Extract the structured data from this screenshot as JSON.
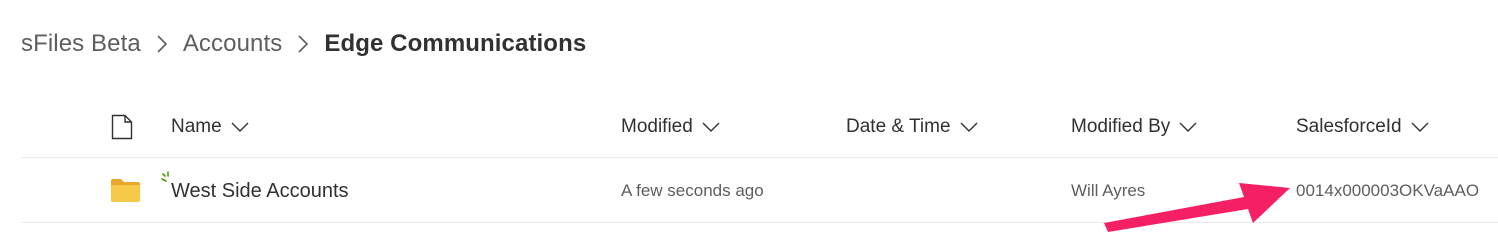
{
  "breadcrumb": {
    "items": [
      "sFiles Beta",
      "Accounts"
    ],
    "current": "Edge Communications"
  },
  "columns": {
    "name": "Name",
    "modified": "Modified",
    "date_time": "Date & Time",
    "modified_by": "Modified By",
    "salesforce_id": "SalesforceId"
  },
  "rows": [
    {
      "name": "West Side Accounts",
      "type_icon": "folder-icon",
      "is_new": true,
      "modified": "A few seconds ago",
      "date_time": "",
      "modified_by": "Will Ayres",
      "salesforce_id": "0014x000003OKVaAAO"
    }
  ],
  "icons": {
    "file_type_header": "document-icon",
    "sort": "chevron-down-icon",
    "separator": "chevron-right-icon",
    "annotation": "arrow-annotation"
  },
  "colors": {
    "folder": "#f7c948",
    "folder_tab": "#e8a92b",
    "new_marker": "#4e9a06",
    "annotation_arrow": "#f51f64",
    "divider": "#edebe9"
  }
}
